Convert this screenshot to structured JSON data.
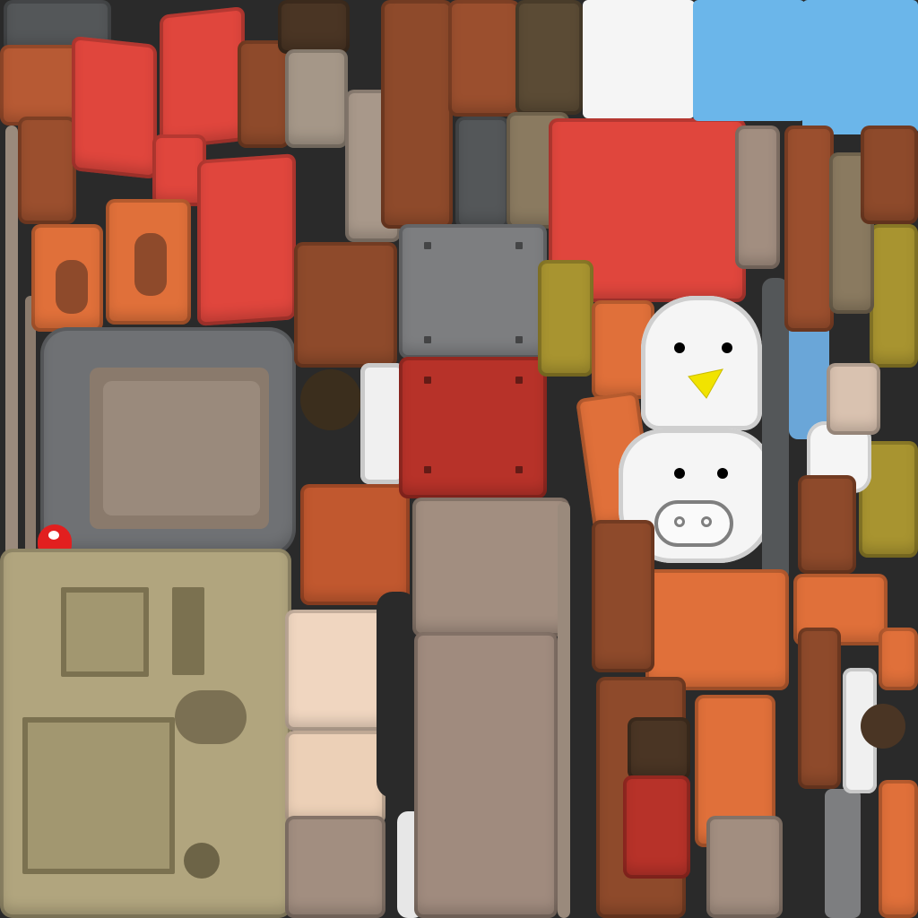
{
  "image": {
    "kind": "texture-atlas",
    "text_visible": false
  },
  "palette": {
    "brick_red": "#e0463d",
    "dark_red": "#9a2b22",
    "rust_orange": "#e0703a",
    "brown": "#8e4a2b",
    "dark_brown": "#4a3524",
    "khaki": "#b1a57e",
    "steel_grey": "#7d7e80",
    "dark_grey": "#545759",
    "beige": "#a89382",
    "cream": "#f0d6c0",
    "sky_blue": "#6bb6ea",
    "white": "#f5f5f5",
    "olive": "#a89430",
    "black": "#2a2a2a",
    "beak_yellow": "#f1e300"
  },
  "decals": [
    {
      "name": "chick-face",
      "colors": [
        "white",
        "beak_yellow",
        "black"
      ]
    },
    {
      "name": "cow-face",
      "colors": [
        "white",
        "black",
        "grey"
      ]
    },
    {
      "name": "mushroom-cap",
      "colors": [
        "brick_red",
        "white"
      ]
    }
  ]
}
